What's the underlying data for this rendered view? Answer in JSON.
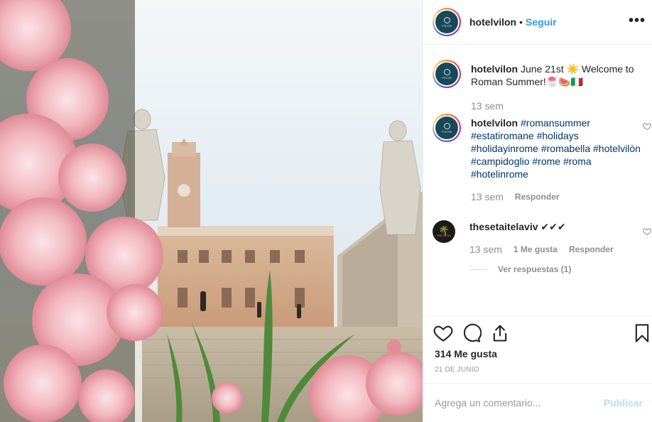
{
  "post": {
    "username": "hotelvilon",
    "follow_label": "Seguir",
    "more_label": "•••",
    "avatar_text": "VILON"
  },
  "comments": [
    {
      "username": "hotelvilon",
      "text_line1": "June 21st ☀️ Welcome to",
      "text_line2": "Roman Summer!🍧🍉🇮🇹",
      "time": "13 sem"
    },
    {
      "username": "hotelvilon",
      "tags": [
        "#romansummer",
        "#estatiromane",
        "#holidays",
        "#holidayinrome",
        "#romabella",
        "#hotelvilòn",
        "#campidoglio",
        "#rome",
        "#roma",
        "#hotelinrome"
      ],
      "time": "13 sem",
      "reply_label": "Responder"
    },
    {
      "username": "thesetaitelaviv",
      "text": "✔✔✔",
      "time": "13 sem",
      "likes_label": "1 Me gusta",
      "reply_label": "Responder",
      "view_replies": "Ver respuestas (1)",
      "avatar_text": "THE SETAI"
    }
  ],
  "actions": {
    "likes": "314 Me gusta",
    "date": "21 DE JUNIO"
  },
  "add_comment": {
    "placeholder": "Agrega un comentario...",
    "publish_label": "Publicar"
  },
  "colors": {
    "link": "#3897f0",
    "hashtag": "#003569",
    "muted": "#8e8e8e",
    "publish_disabled": "#b2dffc"
  }
}
